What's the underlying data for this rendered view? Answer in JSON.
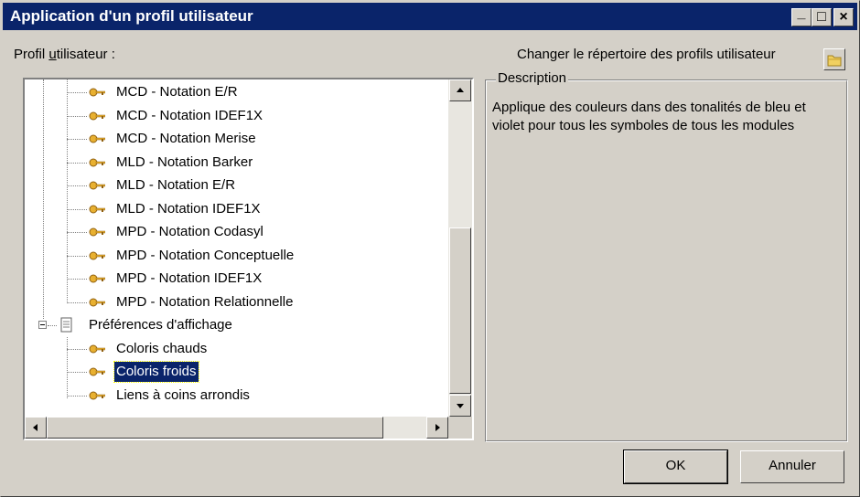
{
  "window": {
    "title": "Application d'un profil utilisateur"
  },
  "titlebar_buttons": [
    "_",
    "□",
    "×"
  ],
  "labels": {
    "profil_pre": "Profil ",
    "profil_u": "u",
    "profil_post": "tilisateur :",
    "change_dir": "Changer le répertoire des profils utilisateur"
  },
  "tree": {
    "items": [
      {
        "label": "MCD - Notation E/R",
        "type": "profile"
      },
      {
        "label": "MCD - Notation IDEF1X",
        "type": "profile"
      },
      {
        "label": "MCD - Notation Merise",
        "type": "profile"
      },
      {
        "label": "MLD - Notation Barker",
        "type": "profile"
      },
      {
        "label": "MLD - Notation E/R",
        "type": "profile"
      },
      {
        "label": "MLD - Notation IDEF1X",
        "type": "profile"
      },
      {
        "label": "MPD - Notation Codasyl",
        "type": "profile"
      },
      {
        "label": "MPD - Notation Conceptuelle",
        "type": "profile"
      },
      {
        "label": "MPD - Notation IDEF1X",
        "type": "profile"
      },
      {
        "label": "MPD - Notation Relationnelle",
        "type": "profile"
      },
      {
        "label": "Préférences d'affichage",
        "type": "folder",
        "expanded": true
      },
      {
        "label": "Coloris chauds",
        "type": "profile"
      },
      {
        "label": "Coloris froids",
        "type": "profile",
        "selected": true
      },
      {
        "label": "Liens à coins arrondis",
        "type": "profile"
      }
    ]
  },
  "description": {
    "legend": "Description",
    "text": "Applique des couleurs dans des tonalités de bleu et violet pour tous les symboles de tous les modules"
  },
  "buttons": {
    "ok": "OK",
    "cancel": "Annuler"
  },
  "colors": {
    "titlebar": "#0a246a",
    "face": "#d4d0c8",
    "selection": "#0a246a",
    "key": "#e8b030"
  }
}
